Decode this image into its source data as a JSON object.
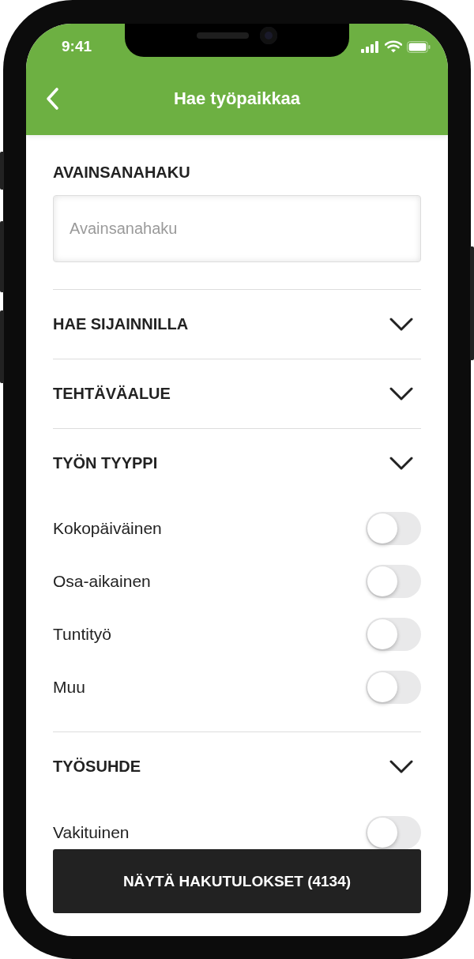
{
  "status_bar": {
    "time": "9:41"
  },
  "header": {
    "title": "Hae työpaikkaa"
  },
  "keyword": {
    "heading": "AVAINSANAHAKU",
    "placeholder": "Avainsanahaku"
  },
  "sections": [
    {
      "heading": "HAE SIJAINNILLA"
    },
    {
      "heading": "TEHTÄVÄALUE"
    },
    {
      "heading": "TYÖN TYYPPI",
      "options": [
        {
          "label": "Kokopäiväinen",
          "on": false
        },
        {
          "label": "Osa-aikainen",
          "on": false
        },
        {
          "label": "Tuntityö",
          "on": false
        },
        {
          "label": "Muu",
          "on": false
        }
      ]
    },
    {
      "heading": "TYÖSUHDE",
      "options": [
        {
          "label": "Vakituinen",
          "on": false
        }
      ]
    }
  ],
  "button": {
    "label": "NÄYTÄ HAKUTULOKSET (4134)"
  }
}
